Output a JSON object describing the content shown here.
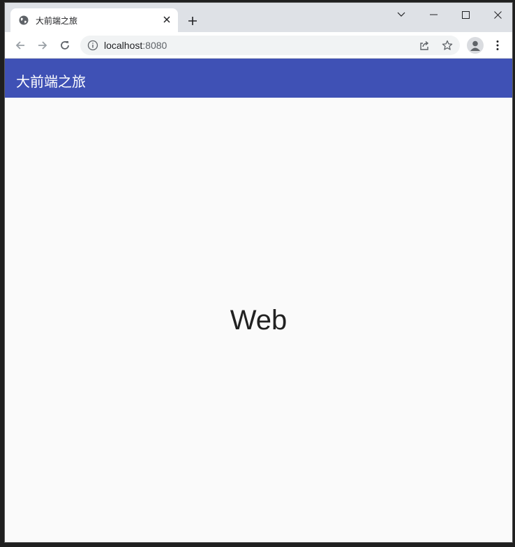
{
  "browser": {
    "tab": {
      "title": "大前端之旅",
      "favicon": "globe-icon"
    },
    "new_tab_symbol": "+",
    "window_controls": [
      "chevron-down-icon",
      "minimize-icon",
      "maximize-icon",
      "close-icon"
    ],
    "address": {
      "host": "localhost",
      "port": ":8080"
    },
    "colors": {
      "tabstrip": "#dee1e6",
      "omnibox": "#f1f3f4"
    }
  },
  "app": {
    "title": "大前端之旅",
    "main_text": "Web",
    "colors": {
      "appbar": "#3f51b5",
      "background": "#fafafa",
      "text": "#212121"
    }
  }
}
